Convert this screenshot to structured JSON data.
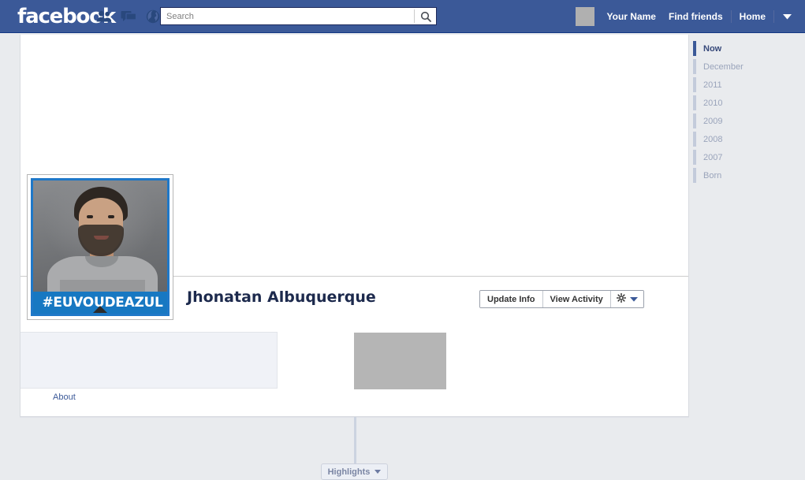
{
  "header": {
    "logo": "facebook",
    "icons": [
      {
        "name": "friend-requests-icon",
        "glyph": "friends"
      },
      {
        "name": "messages-icon",
        "glyph": "message"
      },
      {
        "name": "notifications-icon",
        "glyph": "globe"
      }
    ],
    "search": {
      "placeholder": "Search",
      "value": "",
      "button_icon": "search-icon"
    },
    "account_name": "Your Name",
    "find_friends": "Find friends",
    "home": "Home",
    "account_menu_icon": "chevron-down-icon",
    "bar_color": "#3b5998"
  },
  "profile": {
    "name": "Jhonatan Albuquerque",
    "photo_banner_text": "#EUVOUDEAZUL",
    "photo_frame_color": "#1f78c8",
    "buttons": {
      "update_info": "Update Info",
      "view_activity": "View Activity",
      "settings_icon": "gear-icon",
      "settings_caret_icon": "chevron-down-icon"
    },
    "about_link": "About"
  },
  "timeline_nav": {
    "items": [
      {
        "label": "Now",
        "active": true
      },
      {
        "label": "December",
        "active": false
      },
      {
        "label": "2011",
        "active": false
      },
      {
        "label": "2010",
        "active": false
      },
      {
        "label": "2009",
        "active": false
      },
      {
        "label": "2008",
        "active": false
      },
      {
        "label": "2007",
        "active": false
      },
      {
        "label": "Born",
        "active": false
      }
    ],
    "active_color": "#3b5998",
    "inactive_color": "#c3cbdb"
  },
  "footer": {
    "highlights_label": "Highlights",
    "highlights_caret_icon": "chevron-down-icon"
  }
}
